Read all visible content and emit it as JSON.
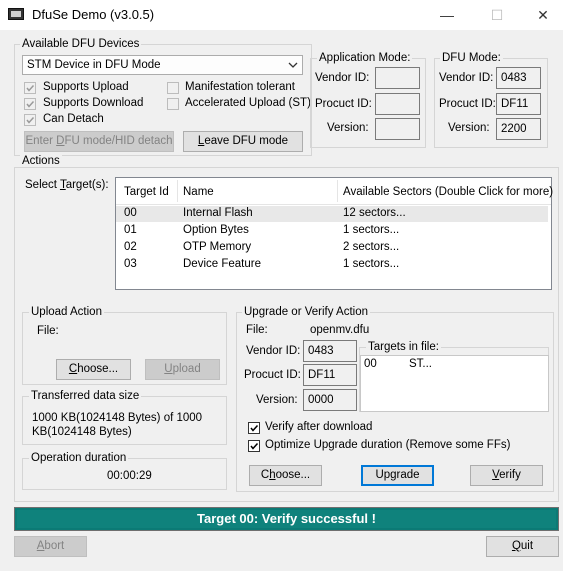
{
  "window": {
    "title": "DfuSe Demo (v3.0.5)",
    "minimize": "—",
    "maximize": "☐",
    "close": "✕"
  },
  "dfu_devices": {
    "label": "Available DFU Devices",
    "selected": "STM Device in DFU Mode",
    "supports_upload": "Supports Upload",
    "supports_download": "Supports Download",
    "can_detach": "Can Detach",
    "manifestation_tolerant": "Manifestation tolerant",
    "accelerated_upload": "Accelerated Upload (ST)",
    "enter_dfu_btn_pre": "Enter ",
    "enter_dfu_btn_u": "D",
    "enter_dfu_btn_post": "FU mode/HID detach",
    "leave_dfu_btn_u": "L",
    "leave_dfu_btn_post": "eave DFU mode"
  },
  "app_mode": {
    "label": "Application Mode:",
    "vendor_label": "Vendor ID:",
    "product_label": "Procuct ID:",
    "version_label": "Version:",
    "vendor_id": "",
    "product_id": "",
    "version": ""
  },
  "dfu_mode": {
    "label": "DFU Mode:",
    "vendor_label": "Vendor ID:",
    "product_label": "Procuct ID:",
    "version_label": "Version:",
    "vendor_id": "0483",
    "product_id": "DF11",
    "version": "2200"
  },
  "actions": {
    "label": "Actions",
    "select_target_pre": "Select ",
    "select_target_u": "T",
    "select_target_post": "arget(s):",
    "columns": [
      "Target Id",
      "Name",
      "Available Sectors (Double Click for more)"
    ],
    "rows": [
      {
        "id": "00",
        "name": "Internal Flash",
        "sectors": "12 sectors..."
      },
      {
        "id": "01",
        "name": "Option Bytes",
        "sectors": "1 sectors..."
      },
      {
        "id": "02",
        "name": "OTP Memory",
        "sectors": "2 sectors..."
      },
      {
        "id": "03",
        "name": "Device Feature",
        "sectors": "1 sectors..."
      }
    ]
  },
  "upload": {
    "label": "Upload Action",
    "file_label": "File:",
    "choose_u": "C",
    "choose_post": "hoose...",
    "upload_u": "U",
    "upload_post": "pload"
  },
  "transferred": {
    "label": "Transferred data size",
    "text_line1": "1000 KB(1024148 Bytes) of 1000",
    "text_line2": "KB(1024148 Bytes)"
  },
  "duration": {
    "label": "Operation duration",
    "value": "00:00:29"
  },
  "upgrade": {
    "label": "Upgrade or Verify Action",
    "file_label": "File:",
    "file_name": "openmv.dfu",
    "vendor_label": "Vendor ID:",
    "product_label": "Procuct ID:",
    "version_label": "Version:",
    "vendor_id": "0483",
    "product_id": "DF11",
    "version": "0000",
    "targets_label": "Targets in file:",
    "target_id": "00",
    "target_name": "ST...",
    "verify_after": "Verify after download",
    "optimize": "Optimize Upgrade duration (Remove some FFs)",
    "choose_pre": "C",
    "choose_u": "h",
    "choose_post": "oose...",
    "upgrade_pre": "Upgrade",
    "verify_u": "V",
    "verify_post": "erify"
  },
  "status": {
    "text": "Target 00: Verify successful !"
  },
  "footer": {
    "abort_u": "A",
    "abort_post": "bort",
    "quit_u": "Q",
    "quit_post": "uit"
  },
  "colors": {
    "status_bg": "#0b7a75",
    "accent": "#0078d7"
  },
  "icons": {
    "app": "dfuse-chip-icon",
    "combo": "chevron-down-icon",
    "check": "checkmark-icon"
  }
}
